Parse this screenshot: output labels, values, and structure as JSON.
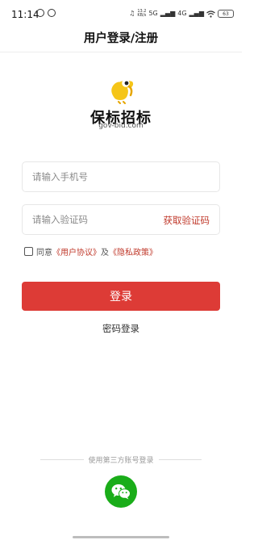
{
  "status_bar": {
    "time": "11:14",
    "net_speed_value": "13.2",
    "net_speed_unit": "KB/s",
    "signal_label": "5G",
    "signal2_label": "4G",
    "battery": "63"
  },
  "header": {
    "title": "用户登录/注册"
  },
  "brand": {
    "name": "保标招标",
    "domain": "gov-bid.com",
    "accent_color": "#f5c518"
  },
  "form": {
    "phone_placeholder": "请输入手机号",
    "code_placeholder": "请输入验证码",
    "get_code_label": "获取验证码",
    "agree_prefix": "同意",
    "user_agreement": "《用户协议》",
    "and": "及",
    "privacy_policy": "《隐私政策》",
    "login_label": "登录",
    "password_login_label": "密码登录"
  },
  "third_party": {
    "label": "使用第三方账号登录",
    "wechat_icon": "wechat-icon"
  },
  "colors": {
    "primary": "#dd3b36",
    "link": "#c0392b",
    "wechat": "#1aad19"
  }
}
